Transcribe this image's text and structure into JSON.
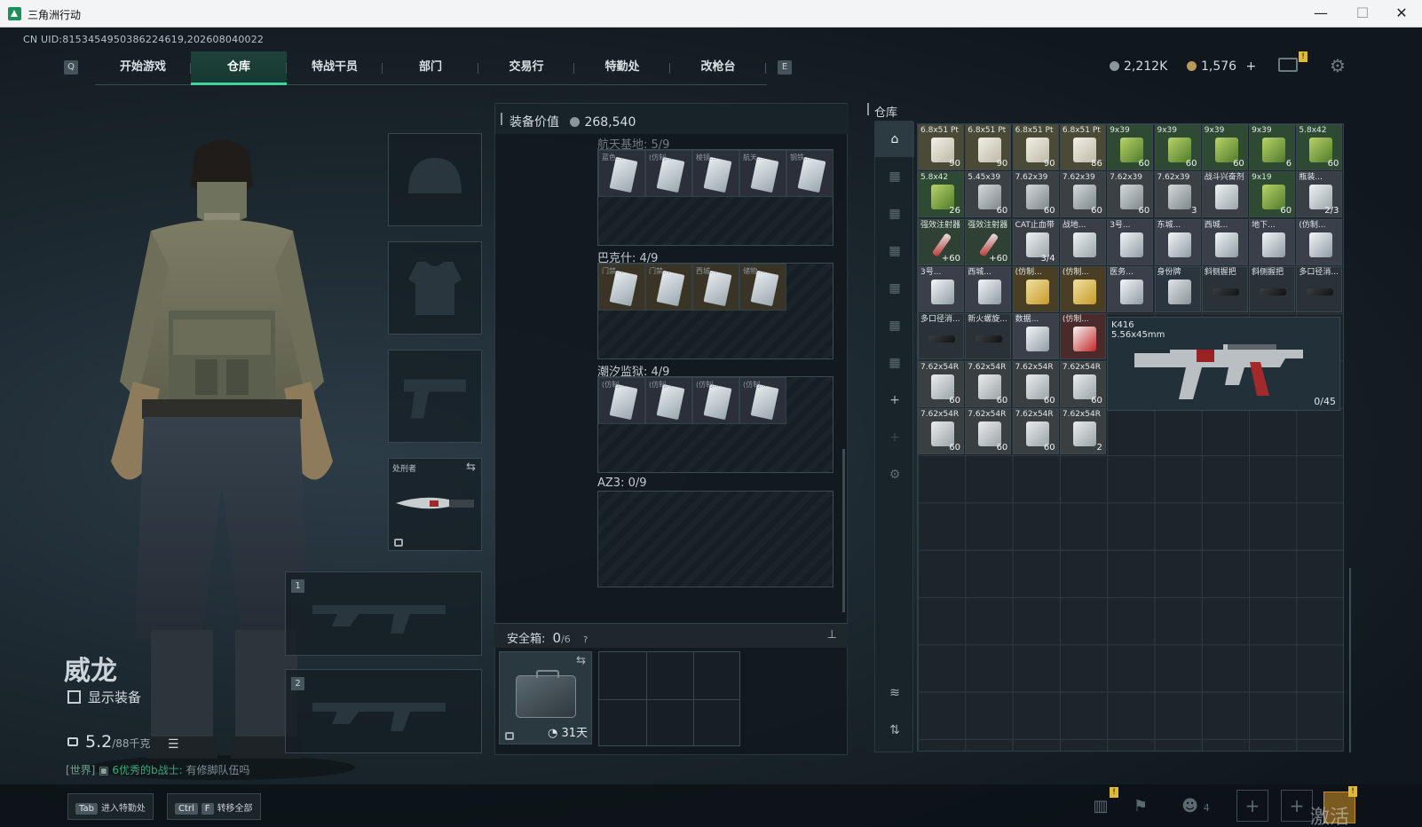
{
  "window": {
    "title": "三角洲行动",
    "minimize": "—",
    "maximize": "☐",
    "close": "✕"
  },
  "uid": "CN UID:8153454950386224619,202608040022",
  "nav": {
    "left_key": "Q",
    "right_key": "E",
    "tabs": [
      {
        "label": "开始游戏"
      },
      {
        "label": "仓库"
      },
      {
        "label": "特战干员"
      },
      {
        "label": "部门"
      },
      {
        "label": "交易行"
      },
      {
        "label": "特勤处"
      },
      {
        "label": "改枪台"
      }
    ],
    "active_tab": "仓库",
    "alert_badge": "!"
  },
  "currency": {
    "coins": "2,212K",
    "tokens": "1,576",
    "tokens_add": "+"
  },
  "operator": {
    "name": "威龙",
    "show_gear_label": "显示装备",
    "weight_value": "5.2",
    "weight_max": "/88千克",
    "chat_prefix": "[世界]",
    "chat_name": "6优秀的b战士:",
    "chat_msg": "有修脚队伍吗"
  },
  "slots": {
    "knife_label": "处刑者",
    "primary_num": "1",
    "secondary_num": "2"
  },
  "equipment": {
    "label": "装备价值",
    "value": "268,540",
    "containers": [
      {
        "label": "航天基地: 5/9",
        "items": [
          "蓝色...",
          "(仿制...",
          "棱镜...",
          "航天...",
          "钢铁..."
        ]
      },
      {
        "label": "巴克什: 4/9",
        "items": [
          "门禁...",
          "门禁...",
          "西城...",
          "储物..."
        ]
      },
      {
        "label": "潮汐监狱: 4/9",
        "items": [
          "(仿制...",
          "(仿制...",
          "(仿制...",
          "(仿制..."
        ]
      },
      {
        "label": "AZ3: 0/9",
        "items": []
      }
    ],
    "safe_label": "安全箱:",
    "safe_count": "0",
    "safe_max": "/6",
    "safe_help": "?",
    "safe_days": "31天"
  },
  "stash": {
    "label": "仓库",
    "items": [
      {
        "name": "6.8x51 Pt",
        "qty": "90",
        "kind": "ammo_white"
      },
      {
        "name": "6.8x51 Pt",
        "qty": "90",
        "kind": "ammo_white"
      },
      {
        "name": "6.8x51 Pt",
        "qty": "90",
        "kind": "ammo_white"
      },
      {
        "name": "6.8x51 Pt",
        "qty": "86",
        "kind": "ammo_white"
      },
      {
        "name": "9x39",
        "qty": "60",
        "kind": "ammo_green"
      },
      {
        "name": "9x39",
        "qty": "60",
        "kind": "ammo_green"
      },
      {
        "name": "9x39",
        "qty": "60",
        "kind": "ammo_green"
      },
      {
        "name": "9x39",
        "qty": "6",
        "kind": "ammo_green"
      },
      {
        "name": "5.8x42",
        "qty": "60",
        "kind": "ammo_green"
      },
      {
        "name": "5.8x42",
        "qty": "26",
        "kind": "ammo_green"
      },
      {
        "name": "5.45x39",
        "qty": "60",
        "kind": "ammo_gray"
      },
      {
        "name": "7.62x39",
        "qty": "60",
        "kind": "ammo_gray"
      },
      {
        "name": "7.62x39",
        "qty": "60",
        "kind": "ammo_gray"
      },
      {
        "name": "7.62x39",
        "qty": "60",
        "kind": "ammo_gray"
      },
      {
        "name": "7.62x39",
        "qty": "3",
        "kind": "ammo_gray"
      },
      {
        "name": "战斗兴奋剂",
        "qty": "",
        "kind": "med"
      },
      {
        "name": "9x19",
        "qty": "60",
        "kind": "ammo_green"
      },
      {
        "name": "瓶装...",
        "qty": "2/3",
        "kind": "med"
      },
      {
        "name": "强效注射器",
        "qty": "+60",
        "kind": "syringe"
      },
      {
        "name": "强效注射器",
        "qty": "+60",
        "kind": "syringe"
      },
      {
        "name": "CAT止血带",
        "qty": "3/4",
        "kind": "med"
      },
      {
        "name": "战地...",
        "qty": "",
        "kind": "med"
      },
      {
        "name": "3号...",
        "qty": "",
        "kind": "card"
      },
      {
        "name": "东城...",
        "qty": "",
        "kind": "card"
      },
      {
        "name": "西城...",
        "qty": "",
        "kind": "card"
      },
      {
        "name": "地下...",
        "qty": "",
        "kind": "card"
      },
      {
        "name": "(仿制...",
        "qty": "",
        "kind": "card"
      },
      {
        "name": "3号...",
        "qty": "",
        "kind": "card"
      },
      {
        "name": "西城...",
        "qty": "",
        "kind": "card"
      },
      {
        "name": "(仿制...",
        "qty": "",
        "kind": "card_gold"
      },
      {
        "name": "(仿制...",
        "qty": "",
        "kind": "card_gold"
      },
      {
        "name": "医务...",
        "qty": "",
        "kind": "card"
      },
      {
        "name": "身份牌",
        "qty": "",
        "kind": "tag"
      },
      {
        "name": "斜侧握把",
        "qty": "",
        "kind": "attach"
      },
      {
        "name": "斜侧握把",
        "qty": "",
        "kind": "attach"
      },
      {
        "name": "多口径消...",
        "qty": "",
        "kind": "attach"
      },
      {
        "name": "多口径消...",
        "qty": "",
        "kind": "attach"
      },
      {
        "name": "新火螺旋...",
        "qty": "",
        "kind": "attach"
      },
      {
        "name": "数据...",
        "qty": "",
        "kind": "card"
      },
      {
        "name": "(仿制...",
        "qty": "",
        "kind": "card_red"
      },
      {
        "name": "7.62x54R",
        "qty": "60",
        "kind": "box"
      },
      {
        "name": "7.62x54R",
        "qty": "60",
        "kind": "box"
      },
      {
        "name": "7.62x54R",
        "qty": "60",
        "kind": "box"
      },
      {
        "name": "7.62x54R",
        "qty": "60",
        "kind": "box"
      },
      {
        "name": "7.62x54R",
        "qty": "60",
        "kind": "box"
      },
      {
        "name": "7.62x54R",
        "qty": "60",
        "kind": "box"
      },
      {
        "name": "7.62x54R",
        "qty": "60",
        "kind": "box"
      },
      {
        "name": "7.62x54R",
        "qty": "2",
        "kind": "box"
      }
    ],
    "gun": {
      "name": "K416",
      "caliber": "5.56x45mm",
      "ammo": "0/45"
    }
  },
  "bottom": {
    "hint1_key": "Tab",
    "hint1_label": "进入特勤处",
    "hint2_key1": "Ctrl",
    "hint2_key2": "F",
    "hint2_label": "转移全部",
    "squad_count": "4",
    "watermark": "激活 Windows"
  },
  "colors": {
    "accent": "#3fd69b",
    "badge": "#e0b937"
  }
}
